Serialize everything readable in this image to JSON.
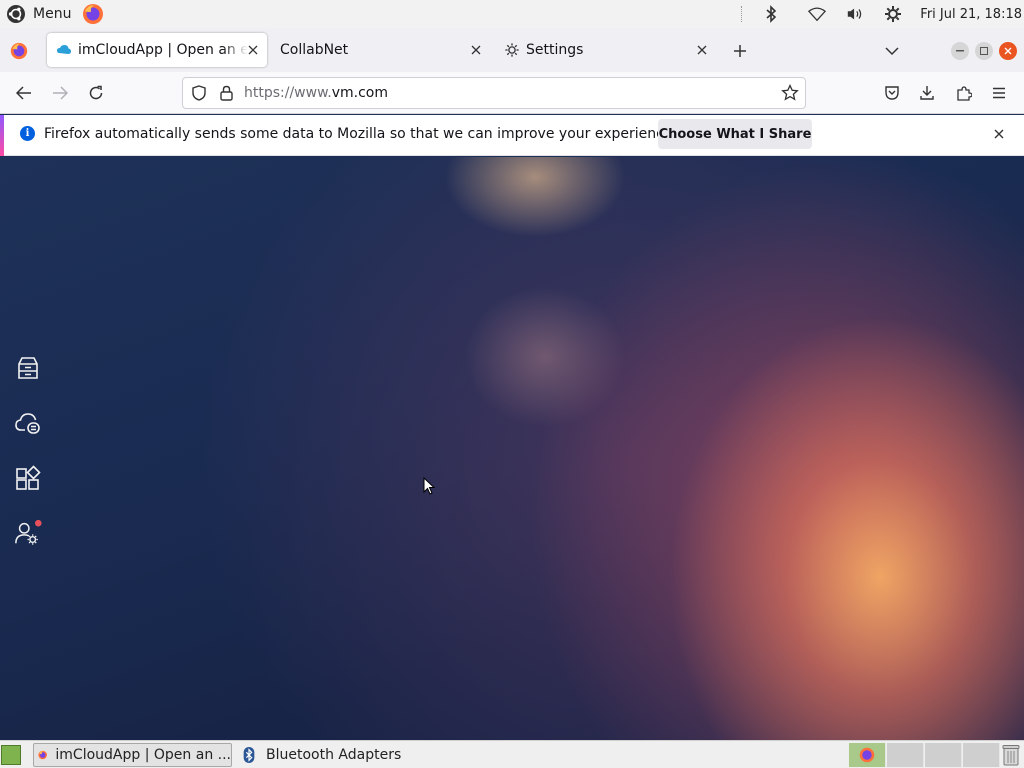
{
  "system_panel": {
    "menu_label": "Menu",
    "clock": "Fri Jul 21, 18:18"
  },
  "browser": {
    "tabs": [
      {
        "title": "imCloudApp | Open an enterprise",
        "active": true
      },
      {
        "title": "CollabNet",
        "active": false
      },
      {
        "title": "Settings",
        "active": false
      }
    ],
    "url_prefix": "https://www.",
    "url_domain": "vm.com"
  },
  "notification": {
    "message": "Firefox automatically sends some data to Mozilla so that we can improve your experience.",
    "button_label": "Choose What I Share"
  },
  "sidebar_icons": [
    "database-icon",
    "cloud-server-icon",
    "apps-icon",
    "user-settings-icon"
  ],
  "taskbar": {
    "items": [
      {
        "label": "imCloudApp | Open an ...",
        "active": true
      },
      {
        "label": "Bluetooth Adapters",
        "active": false
      }
    ]
  },
  "colors": {
    "accent": "#0060df",
    "notification_accent": "#9059ff",
    "badge": "#e8505b",
    "workspace_active": "#a9c98a"
  }
}
